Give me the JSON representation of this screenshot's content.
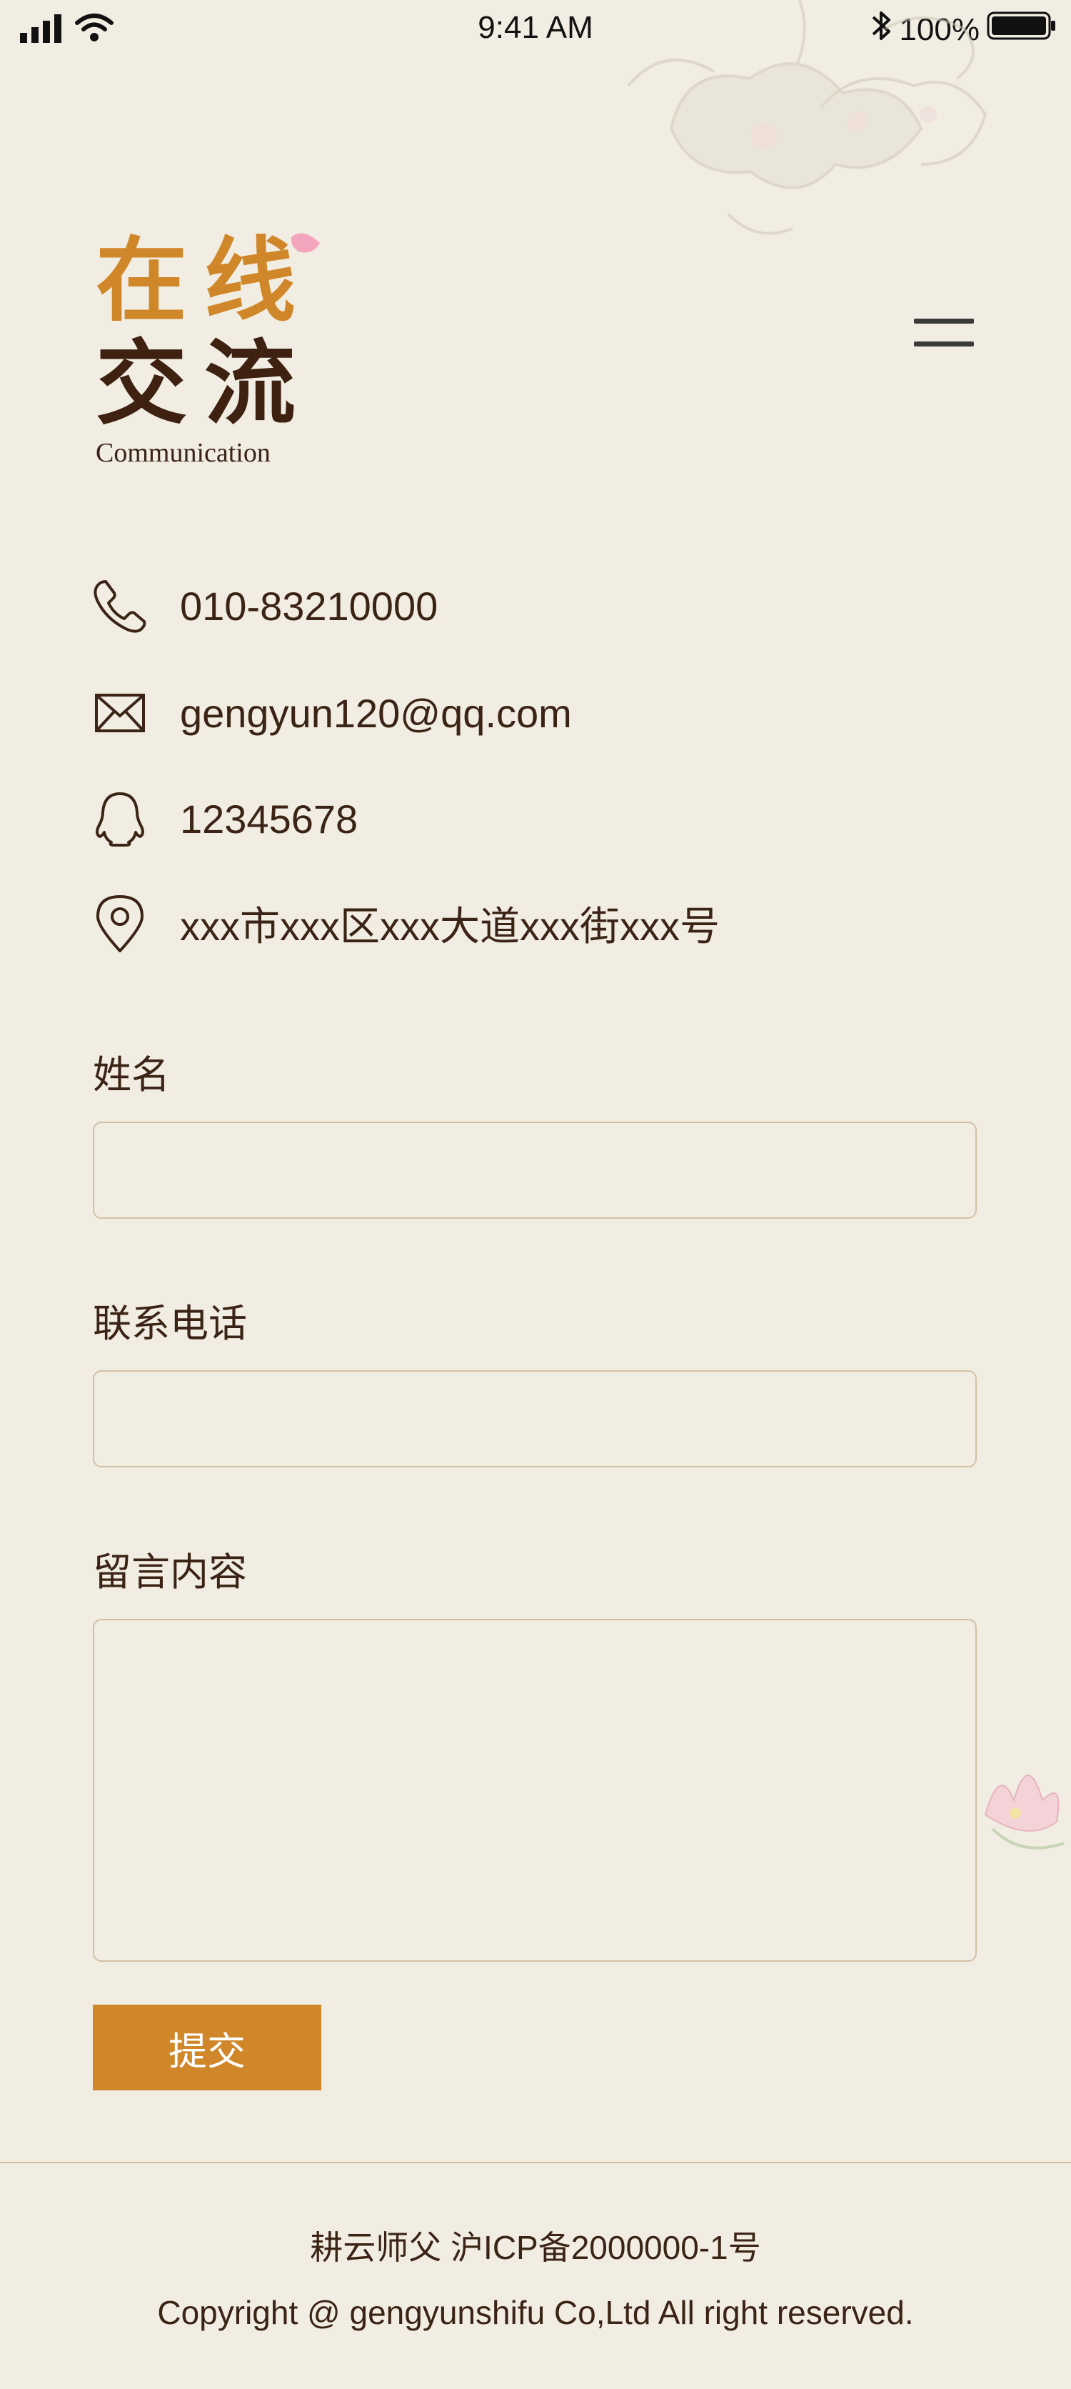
{
  "status_bar": {
    "time": "9:41 AM",
    "battery": "100%"
  },
  "header": {
    "title_line1": "在线",
    "title_line2": "交流",
    "subtitle": "Communication",
    "menu_icon": "hamburger-menu-icon"
  },
  "contacts": [
    {
      "icon": "phone-icon",
      "text": "010-83210000"
    },
    {
      "icon": "email-icon",
      "text": "gengyun120@qq.com"
    },
    {
      "icon": "qq-icon",
      "text": "12345678"
    },
    {
      "icon": "location-pin-icon",
      "text": "xxx市xxx区xxx大道xxx街xxx号"
    }
  ],
  "form": {
    "name_label": "姓名",
    "name_value": "",
    "phone_label": "联系电话",
    "phone_value": "",
    "message_label": "留言内容",
    "message_value": "",
    "submit_label": "提交"
  },
  "footer": {
    "icp": "耕云师父 沪ICP备2000000-1号",
    "copyright": "Copyright @ gengyunshifu Co,Ltd All right reserved."
  },
  "colors": {
    "background": "#f1ede3",
    "accent": "#d08729",
    "text_dark": "#3b2415",
    "border": "#d4bfa5"
  }
}
